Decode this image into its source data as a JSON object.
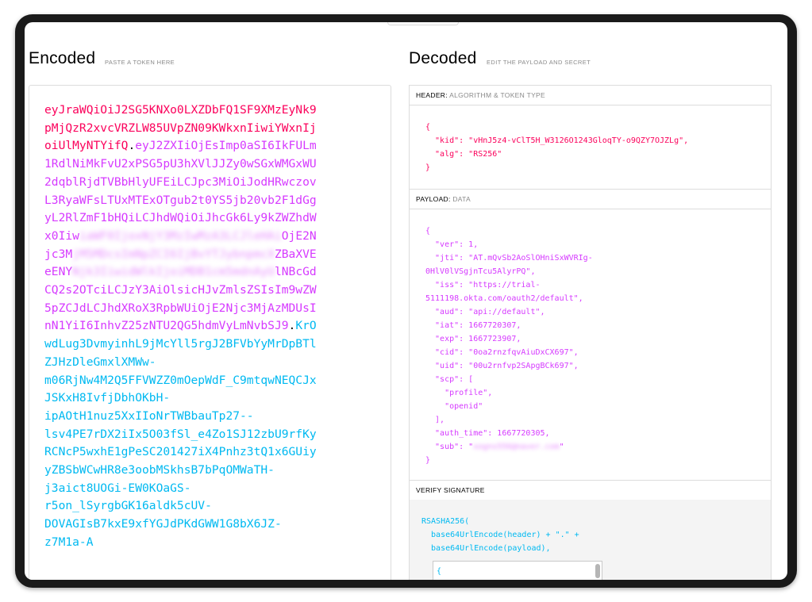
{
  "encoded": {
    "title": "Encoded",
    "subtitle": "PASTE A TOKEN HERE",
    "lines": [
      [
        {
          "t": "h",
          "v": "eyJraWQiOiJ2SG5KNXo0LXZDbFQ1SF9XMzEyNk9"
        }
      ],
      [
        {
          "t": "h",
          "v": "pMjQzR2xvcVRZLW85UVpZN09KWkxnIiwiYWxnIj"
        }
      ],
      [
        {
          "t": "h",
          "v": "oiUlMyNTYifQ"
        },
        {
          "t": "d",
          "v": "."
        },
        {
          "t": "p",
          "v": "eyJ2ZXIiOjEsImp0aSI6IkFULm"
        }
      ],
      [
        {
          "t": "p",
          "v": "1RdlNiMkFvU2xPSG5pU3hXVlJJZy0wSGxWMGxWU"
        }
      ],
      [
        {
          "t": "p",
          "v": "2dqblRjdTVBbHlyUFEiLCJpc3MiOiJodHRwczov"
        }
      ],
      [
        {
          "t": "p",
          "v": "L3RyaWFsLTUxMTExOTgub2t0YS5jb20vb2F1dGg"
        }
      ],
      [
        {
          "t": "p",
          "v": "yL2RlZmF1bHQiLCJhdWQiOiJhcGk6Ly9kZWZhdW"
        }
      ],
      [
        {
          "t": "p",
          "v": "x0Iiw"
        },
        {
          "t": "b",
          "v": "iaWF0IjoxNjY3MzIwMzA3LCJleHAi"
        },
        {
          "t": "p",
          "v": "OjE2N"
        }
      ],
      [
        {
          "t": "p",
          "v": "jc3M"
        },
        {
          "t": "b",
          "v": "jM5MDcsImNpZCI6IjBvYTJybnpmcX"
        },
        {
          "t": "p",
          "v": "ZBaXVE"
        }
      ],
      [
        {
          "t": "p",
          "v": "eENY"
        },
        {
          "t": "b",
          "v": "Njk3IiwidWlkIjoiMDB1cm5mdnAyU"
        },
        {
          "t": "p",
          "v": "lNBcGd"
        }
      ],
      [
        {
          "t": "p",
          "v": "CQ2s2OTciLCJzY3AiOlsicHJvZmlsZSIsIm9wZW"
        }
      ],
      [
        {
          "t": "p",
          "v": "5pZCJdLCJhdXRoX3RpbWUiOjE2Njc3MjAzMDUsI"
        }
      ],
      [
        {
          "t": "p",
          "v": "nN1YiI6InhvZ25zNTU2QG5hdmVyLmNvbSJ9"
        },
        {
          "t": "d",
          "v": "."
        },
        {
          "t": "s",
          "v": "KrO"
        }
      ],
      [
        {
          "t": "s",
          "v": "wdLug3DvmyinhL9jMcYll5rgJ2BFVbYyMrDpBTl"
        }
      ],
      [
        {
          "t": "s",
          "v": "ZJHzDleGmxlXMWw-"
        }
      ],
      [
        {
          "t": "s",
          "v": "m06RjNw4M2Q5FFVWZZ0mOepWdF_C9mtqwNEQCJx"
        }
      ],
      [
        {
          "t": "s",
          "v": "JSKxH8IvfjDbhOKbH-"
        }
      ],
      [
        {
          "t": "s",
          "v": "ipAOtH1nuz5XxIIoNrTWBbauTp27--"
        }
      ],
      [
        {
          "t": "s",
          "v": "lsv4PE7rDX2iIx5O03fSl_e4Zo1SJ12zbU9rfKy"
        }
      ],
      [
        {
          "t": "s",
          "v": "RCNcP5wxhE1gPeSC201427iX4Pnhz3tQ1x6GUiy"
        }
      ],
      [
        {
          "t": "s",
          "v": "yZBSbWCwHR8e3oobMSkhsB7bPqOMWaTH-"
        }
      ],
      [
        {
          "t": "s",
          "v": "j3aict8UOGi-EW0KOaGS-"
        }
      ],
      [
        {
          "t": "s",
          "v": "r5on_lSyrgbGK16aldk5cUV-"
        }
      ],
      [
        {
          "t": "s",
          "v": "DOVAGIsB7kxE9xfYGJdPKdGWW1G8bX6JZ-"
        }
      ],
      [
        {
          "t": "s",
          "v": "z7M1a-A"
        }
      ]
    ]
  },
  "decoded": {
    "title": "Decoded",
    "subtitle": "EDIT THE PAYLOAD AND SECRET",
    "header_section": {
      "label": "HEADER:",
      "sublabel": "ALGORITHM & TOKEN TYPE",
      "lines": [
        [
          {
            "c": "red",
            "v": "{"
          }
        ],
        [
          {
            "c": "red",
            "v": "  \"kid\": \"vHnJ5z4-vClT5H_W3126O1243GloqTY-o9QZY7OJZLg\","
          }
        ],
        [
          {
            "c": "red",
            "v": "  \"alg\": \"RS256\""
          }
        ],
        [
          {
            "c": "red",
            "v": "}"
          }
        ]
      ]
    },
    "payload_section": {
      "label": "PAYLOAD:",
      "sublabel": "DATA",
      "lines": [
        [
          {
            "c": "mag",
            "v": "{"
          }
        ],
        [
          {
            "c": "mag",
            "v": "  \"ver\": 1,"
          }
        ],
        [
          {
            "c": "mag",
            "v": "  \"jti\": \"AT.mQvSb2AoSlOHniSxWVRIg-"
          }
        ],
        [
          {
            "c": "mag",
            "v": "0HlV0lVSgjnTcu5AlyrPQ\","
          }
        ],
        [
          {
            "c": "mag",
            "v": "  \"iss\": \"https://trial-"
          }
        ],
        [
          {
            "c": "mag",
            "v": "5111198.okta.com/oauth2/default\","
          }
        ],
        [
          {
            "c": "mag",
            "v": "  \"aud\": \"api://default\","
          }
        ],
        [
          {
            "c": "mag",
            "v": "  \"iat\": 1667720307,"
          }
        ],
        [
          {
            "c": "mag",
            "v": "  \"exp\": 1667723907,"
          }
        ],
        [
          {
            "c": "mag",
            "v": "  \"cid\": \"0oa2rnzfqvAiuDxCX697\","
          }
        ],
        [
          {
            "c": "mag",
            "v": "  \"uid\": \"00u2rnfvp2SApgBCk697\","
          }
        ],
        [
          {
            "c": "mag",
            "v": "  \"scp\": ["
          }
        ],
        [
          {
            "c": "mag",
            "v": "    \"profile\","
          }
        ],
        [
          {
            "c": "mag",
            "v": "    \"openid\""
          }
        ],
        [
          {
            "c": "mag",
            "v": "  ],"
          }
        ],
        [
          {
            "c": "mag",
            "v": "  \"auth_time\": 1667720305,"
          }
        ],
        [
          {
            "c": "mag",
            "v": "  \"sub\": \""
          },
          {
            "c": "mag blur-text",
            "v": "xogns556@naver.com"
          },
          {
            "c": "mag",
            "v": "\""
          }
        ],
        [
          {
            "c": "mag",
            "v": "}"
          }
        ]
      ]
    },
    "signature_section": {
      "label": "VERIFY SIGNATURE",
      "lines": [
        [
          {
            "c": "blue",
            "v": "RSASHA256("
          }
        ],
        [
          {
            "c": "blue",
            "v": "  base64UrlEncode(header) + \".\" +"
          }
        ],
        [
          {
            "c": "blue",
            "v": "  base64UrlEncode(payload),"
          }
        ]
      ],
      "input_value": "{"
    }
  }
}
